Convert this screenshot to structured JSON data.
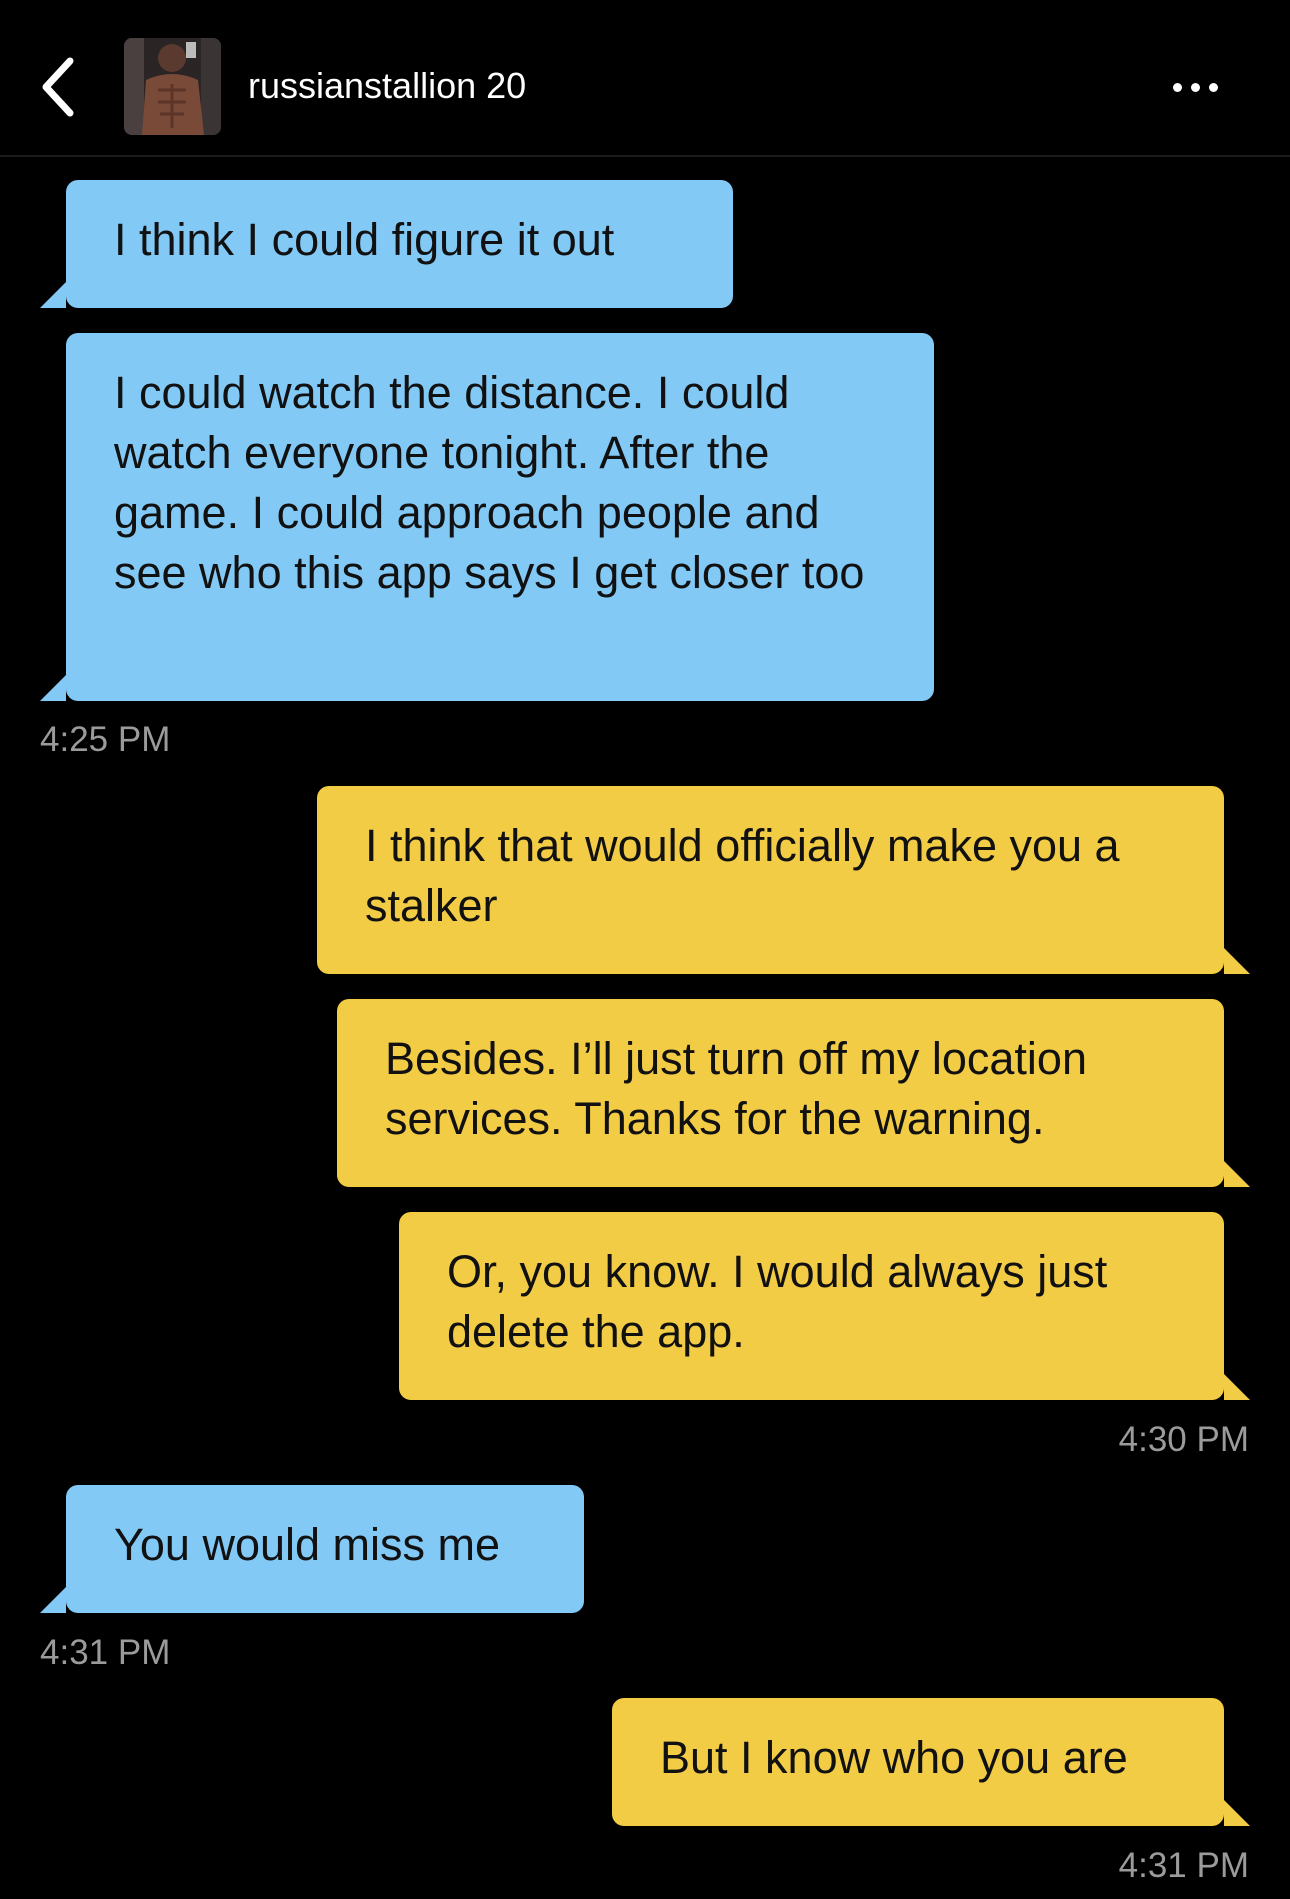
{
  "header": {
    "back_icon": "chevron-left-icon",
    "avatar_icon": "profile-photo",
    "username": "russianstallion 20",
    "more_icon": "more-dots-icon"
  },
  "messages": [
    {
      "sender": "them",
      "text": "I think I could figure it out"
    },
    {
      "sender": "them",
      "text": "I could watch the distance. I could watch everyone tonight. After the game. I could approach people and see who this app says I get closer too"
    },
    {
      "sender": "me",
      "text": "I think that would officially make you a stalker"
    },
    {
      "sender": "me",
      "text": "Besides. I’ll just turn off my location services. Thanks for the warning."
    },
    {
      "sender": "me",
      "text": "Or, you know. I would always just delete the app."
    },
    {
      "sender": "them",
      "text": "You would miss me"
    },
    {
      "sender": "me",
      "text": "But I know who you are"
    }
  ],
  "timestamps": [
    "4:25 PM",
    "4:30 PM",
    "4:31 PM",
    "4:31 PM"
  ],
  "colors": {
    "incoming_bubble": "#82c9f6",
    "outgoing_bubble": "#f3cc46",
    "background": "#000000",
    "timestamp": "#9b9b9b"
  }
}
